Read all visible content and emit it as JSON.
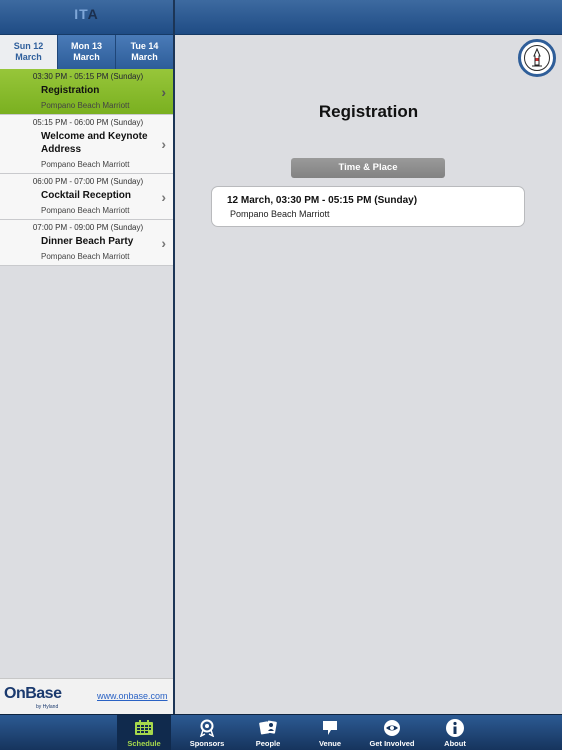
{
  "header": {
    "logo_text": "IT",
    "logo_accent": "A"
  },
  "tabs": [
    {
      "label": "Sun 12 March",
      "active": true
    },
    {
      "label": "Mon 13 March",
      "active": false
    },
    {
      "label": "Tue 14 March",
      "active": false
    }
  ],
  "sessions": [
    {
      "time": "03:30 PM - 05:15 PM (Sunday)",
      "title": "Registration",
      "place": "Pompano Beach Marriott",
      "selected": true
    },
    {
      "time": "05:15 PM - 06:00 PM (Sunday)",
      "title": "Welcome and Keynote Address",
      "place": "Pompano Beach Marriott",
      "selected": false
    },
    {
      "time": "06:00 PM - 07:00 PM (Sunday)",
      "title": "Cocktail Reception",
      "place": "Pompano Beach Marriott",
      "selected": false
    },
    {
      "time": "07:00 PM - 09:00 PM (Sunday)",
      "title": "Dinner Beach Party",
      "place": "Pompano Beach Marriott",
      "selected": false
    }
  ],
  "sponsor": {
    "name": "OnBase",
    "sub": "by Hyland",
    "link": "www.onbase.com"
  },
  "detail": {
    "title": "Registration",
    "section_label": "Time & Place",
    "datetime": "12 March, 03:30 PM - 05:15 PM (Sunday)",
    "place": "Pompano Beach Marriott"
  },
  "tabbar": [
    {
      "label": "Schedule",
      "icon": "calendar-icon",
      "active": true
    },
    {
      "label": "Sponsors",
      "icon": "award-icon",
      "active": false
    },
    {
      "label": "People",
      "icon": "people-icon",
      "active": false
    },
    {
      "label": "Venue",
      "icon": "map-pin-icon",
      "active": false
    },
    {
      "label": "Get Involved",
      "icon": "handshake-icon",
      "active": false
    },
    {
      "label": "About",
      "icon": "info-icon",
      "active": false
    }
  ],
  "colors": {
    "accent_green": "#97c63a",
    "nav_blue": "#1f4c85"
  }
}
